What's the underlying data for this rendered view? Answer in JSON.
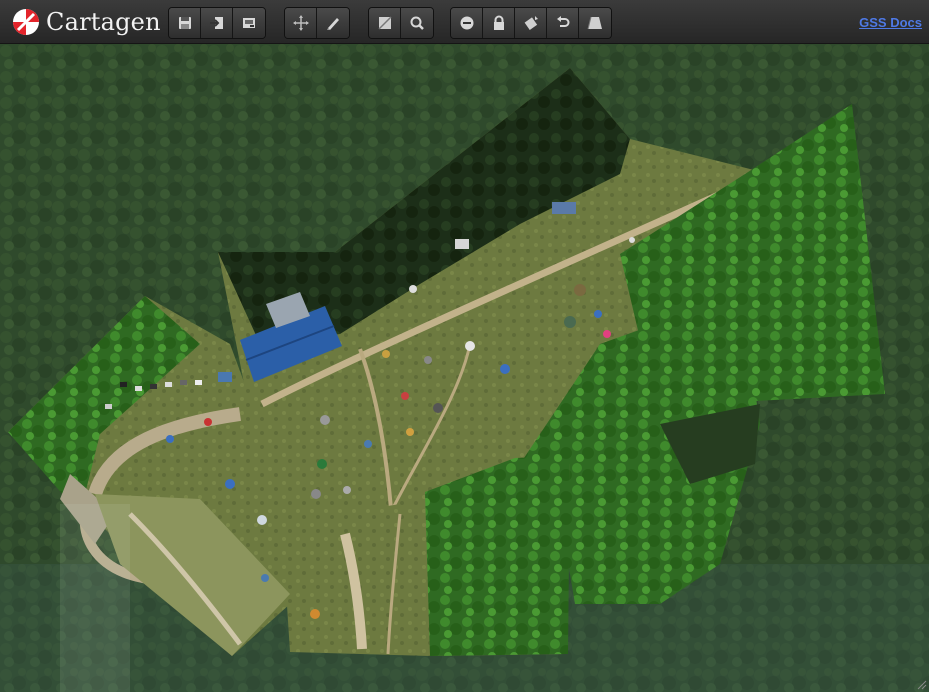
{
  "app": {
    "name": "Cartagen"
  },
  "toolbar": {
    "groups": [
      {
        "buttons": [
          {
            "icon": "save-icon"
          },
          {
            "icon": "import-icon"
          },
          {
            "icon": "export-icon"
          }
        ]
      },
      {
        "buttons": [
          {
            "icon": "move-icon"
          },
          {
            "icon": "draw-icon"
          }
        ]
      },
      {
        "buttons": [
          {
            "icon": "image-icon"
          },
          {
            "icon": "zoom-icon"
          }
        ]
      },
      {
        "buttons": [
          {
            "icon": "delete-icon"
          },
          {
            "icon": "lock-icon"
          },
          {
            "icon": "rotate-icon"
          },
          {
            "icon": "undo-icon"
          },
          {
            "icon": "distort-icon"
          }
        ]
      }
    ],
    "docs_label": "GSS Docs"
  },
  "colors": {
    "toolbar_bg": "#2d2d2d",
    "link": "#4e79e5",
    "logo_red": "#e3242b",
    "forest_dark": "#2f4a2c",
    "field": "#6b7a3e",
    "building_roof": "#2b5fa8"
  }
}
